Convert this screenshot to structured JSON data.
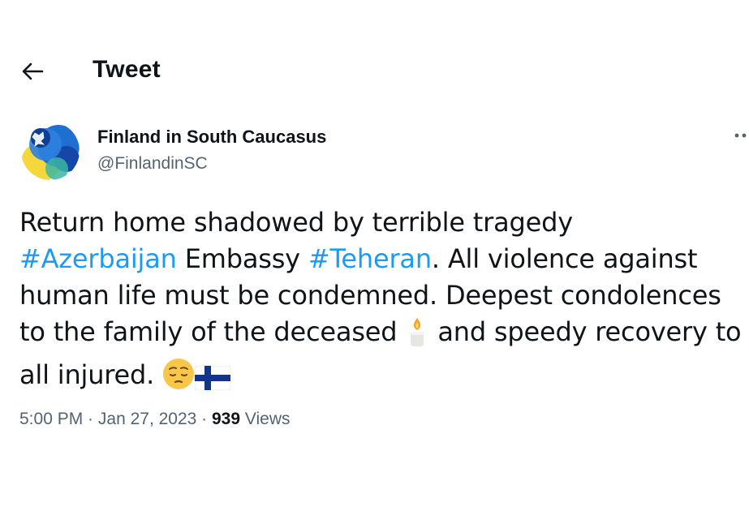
{
  "header": {
    "title": "Tweet"
  },
  "author": {
    "name": "Finland in South Caucasus",
    "handle": "@FinlandinSC"
  },
  "tweet": {
    "line1": "Return home shadowed by terrible tragedy",
    "hashtag1": "#Azerbaijan",
    "text2": " Embassy ",
    "hashtag2": "#Teheran",
    "text3": ". All violence against human life must be condemned. Deepest condolences to the family of the deceased ",
    "text4": " and speedy recovery to all injured. "
  },
  "meta": {
    "time": "5:00 PM",
    "sep1": " · ",
    "date": "Jan 27, 2023",
    "sep2": " · ",
    "views_count": "939",
    "views_label": " Views"
  },
  "icons": {
    "back": "arrow-left-icon",
    "more": "more-horizontal-icon",
    "candle": "candle-emoji",
    "pensive": "pensive-face-emoji",
    "flag": "finland-flag-emoji"
  },
  "colors": {
    "link": "#1d9bf0",
    "text": "#0f1419",
    "muted": "#536471"
  }
}
